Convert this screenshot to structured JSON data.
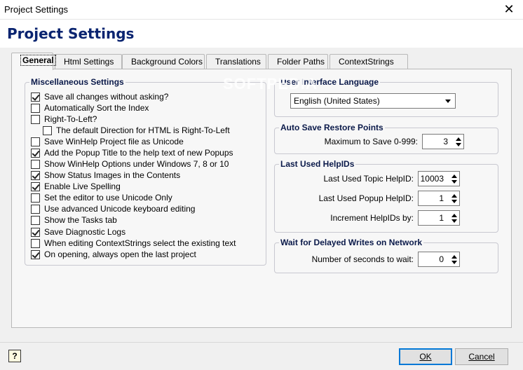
{
  "window": {
    "title": "Project Settings",
    "close_glyph": "✕"
  },
  "header": {
    "title": "Project Settings"
  },
  "tabs": [
    {
      "label": "General",
      "active": true
    },
    {
      "label": "Html Settings",
      "active": false
    },
    {
      "label": "Background Colors",
      "active": false
    },
    {
      "label": "Translations",
      "active": false
    },
    {
      "label": "Folder Paths",
      "active": false
    },
    {
      "label": "ContextStrings",
      "active": false
    }
  ],
  "misc": {
    "title": "Miscellaneous Settings",
    "items": [
      {
        "label": "Save all changes without asking?",
        "checked": true
      },
      {
        "label": "Automatically Sort the Index",
        "checked": false
      },
      {
        "label": "Right-To-Left?",
        "checked": false
      },
      {
        "label": "The default Direction for HTML is Right-To-Left",
        "checked": false
      },
      {
        "label": "Save WinHelp Project file as Unicode",
        "checked": false
      },
      {
        "label": "Add the Popup Title to the help text of new Popups",
        "checked": true
      },
      {
        "label": "Show WinHelp Options under Windows 7, 8 or 10",
        "checked": false
      },
      {
        "label": "Show Status Images in the Contents",
        "checked": true
      },
      {
        "label": "Enable Live Spelling",
        "checked": true
      },
      {
        "label": "Set the editor to use Unicode Only",
        "checked": false
      },
      {
        "label": "Use advanced Unicode keyboard editing",
        "checked": false
      },
      {
        "label": "Show the Tasks tab",
        "checked": false
      },
      {
        "label": "Save Diagnostic Logs",
        "checked": true
      },
      {
        "label": "When editing ContextStrings select the existing text",
        "checked": false
      },
      {
        "label": "On opening, always open the last project",
        "checked": true
      }
    ]
  },
  "language": {
    "title": "User Interface Language",
    "selected": "English (United States)"
  },
  "autosave": {
    "title": "Auto Save Restore Points",
    "label": "Maximum to Save 0-999:",
    "value": "3"
  },
  "helpids": {
    "title": "Last Used HelpIDs",
    "topic_label": "Last Used Topic HelpID:",
    "topic_value": "10003",
    "popup_label": "Last Used Popup HelpID:",
    "popup_value": "1",
    "increment_label": "Increment HelpIDs by:",
    "increment_value": "1"
  },
  "network": {
    "title": "Wait for Delayed Writes on Network",
    "label": "Number of seconds to wait:",
    "value": "0"
  },
  "watermark": "SOFTPEDIA",
  "footer": {
    "help_glyph": "?",
    "ok_label": "OK",
    "cancel_label": "Cancel"
  }
}
